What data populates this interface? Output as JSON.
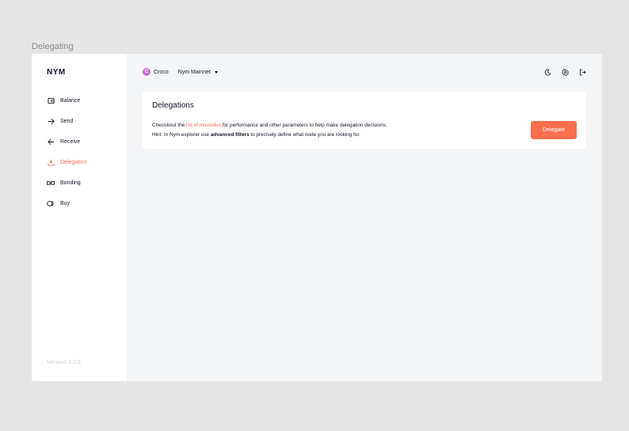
{
  "frame_label": "Delegating",
  "sidebar": {
    "logo": "NYM",
    "items": [
      {
        "label": "Balance",
        "icon": "wallet-icon",
        "active": false
      },
      {
        "label": "Send",
        "icon": "arrow-right-icon",
        "active": false
      },
      {
        "label": "Receive",
        "icon": "arrow-left-icon",
        "active": false
      },
      {
        "label": "Delegation",
        "icon": "delegate-icon",
        "active": true
      },
      {
        "label": "Bonding",
        "icon": "bonding-icon",
        "active": false
      },
      {
        "label": "Buy",
        "icon": "coins-icon",
        "active": false
      }
    ],
    "version": "Version: 1.0.5"
  },
  "topbar": {
    "avatar_letter": "C",
    "username": "Croco",
    "network": "Nym Mainnet",
    "icons": [
      "moon-icon",
      "settings-icon",
      "logout-icon"
    ]
  },
  "card": {
    "title": "Delegations",
    "line1_before": "Checokout the ",
    "line1_link": "list of mixnodes",
    "line1_after": " for performance and other parameters to help make delegation decisions.",
    "line2_before": "Hint: In Nym explorer use ",
    "line2_bold": "advanced filters",
    "line2_after": " to precisely define what node you are looking for.",
    "button": "Delegate"
  },
  "colors": {
    "accent": "#fb6e4e",
    "avatar": "#c770d3",
    "background": "#f4f5f7"
  }
}
